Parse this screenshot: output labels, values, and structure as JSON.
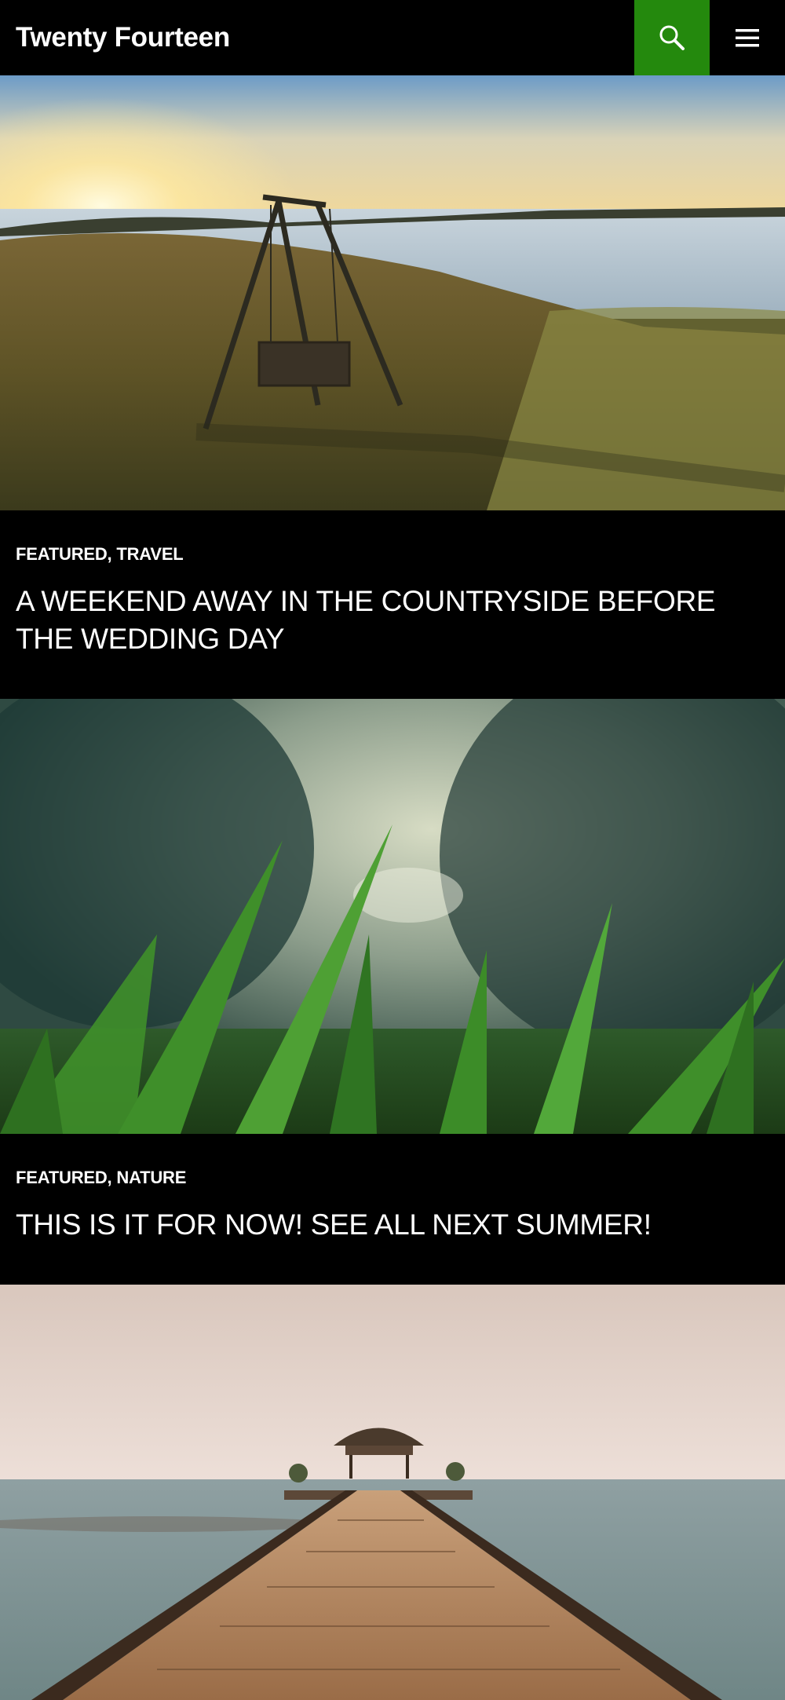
{
  "site": {
    "title": "Twenty Fourteen",
    "accent_color": "#24890d"
  },
  "header": {
    "search_icon": "search-icon",
    "menu_icon": "hamburger-menu-icon"
  },
  "posts": [
    {
      "categories": [
        "FEATURED",
        "TRAVEL"
      ],
      "separator": ", ",
      "title": "A WEEKEND AWAY IN THE COUNTRYSIDE BEFORE THE WEDDING DAY",
      "image": "sunset-swing-by-lake-photo"
    },
    {
      "categories": [
        "FEATURED",
        "NATURE"
      ],
      "separator": ", ",
      "title": "THIS IS IT FOR NOW! SEE ALL NEXT SUMMER!",
      "image": "grass-closeup-photo"
    },
    {
      "image": "wooden-pier-to-hut-photo"
    }
  ]
}
